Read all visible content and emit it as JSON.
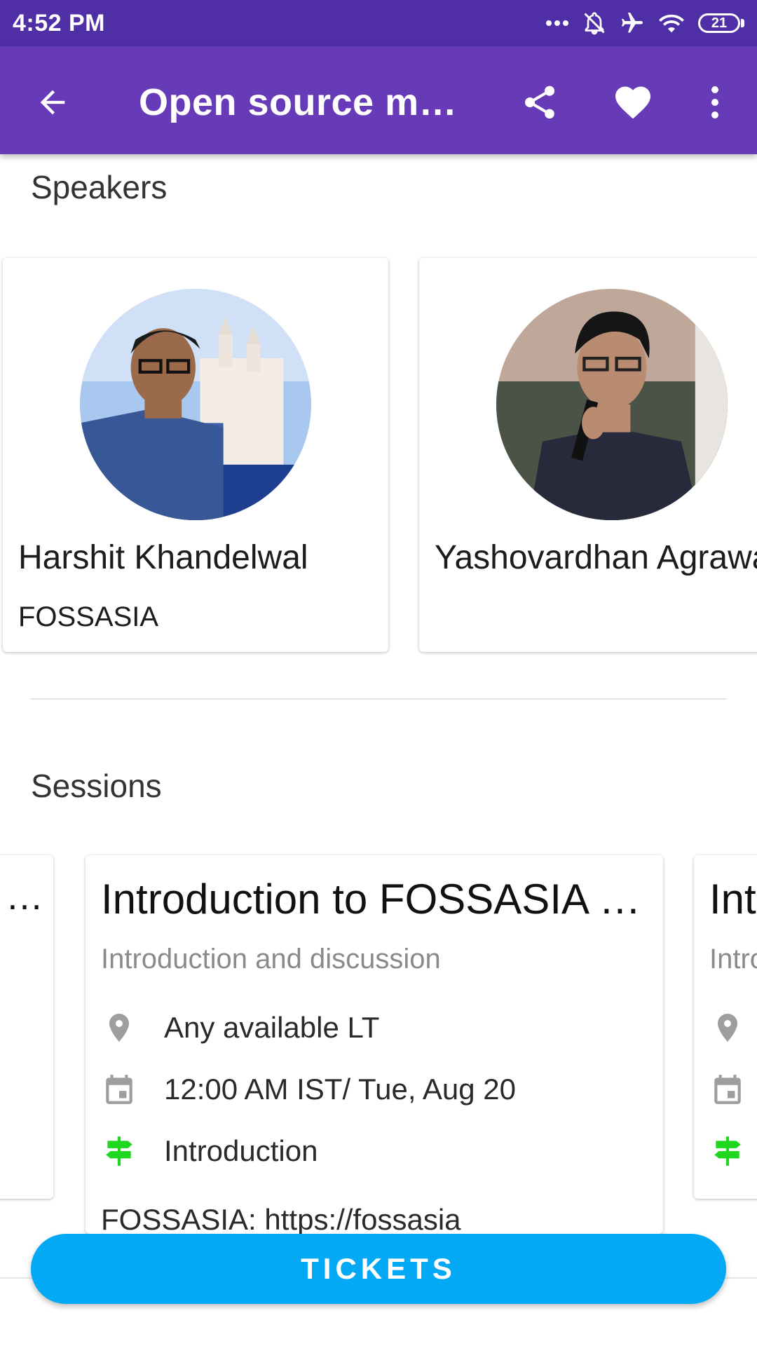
{
  "status_bar": {
    "time": "4:52 PM",
    "battery": "21",
    "icons": [
      "more-dots-icon",
      "notifications-off-icon",
      "airplane-icon",
      "wifi-icon",
      "battery-icon"
    ]
  },
  "app_bar": {
    "title": "Open source meetup",
    "icons": [
      "arrow-back-icon",
      "share-icon",
      "heart-icon",
      "more-vert-icon"
    ],
    "color": "#673ab7"
  },
  "speakers": {
    "title": "Speakers",
    "items": [
      {
        "name": "Harshit Khandelwal",
        "organization": "FOSSASIA"
      },
      {
        "name": "Yashovardhan Agrawal",
        "organization": ""
      }
    ]
  },
  "sessions": {
    "title": "Sessions",
    "prev_card_text": "…",
    "main": {
      "title": "Introduction to FOSSASIA and Open Source",
      "subtitle": "Introduction and discussion",
      "location": "Any available LT",
      "datetime": "12:00 AM IST/ Tue, Aug 20",
      "track": "Introduction",
      "description": "FOSSASIA: https://fossasia"
    },
    "next": {
      "title": "Int",
      "subtitle": "Intro"
    }
  },
  "tickets_button": {
    "label": "TICKETS",
    "color": "#03a9f4"
  }
}
